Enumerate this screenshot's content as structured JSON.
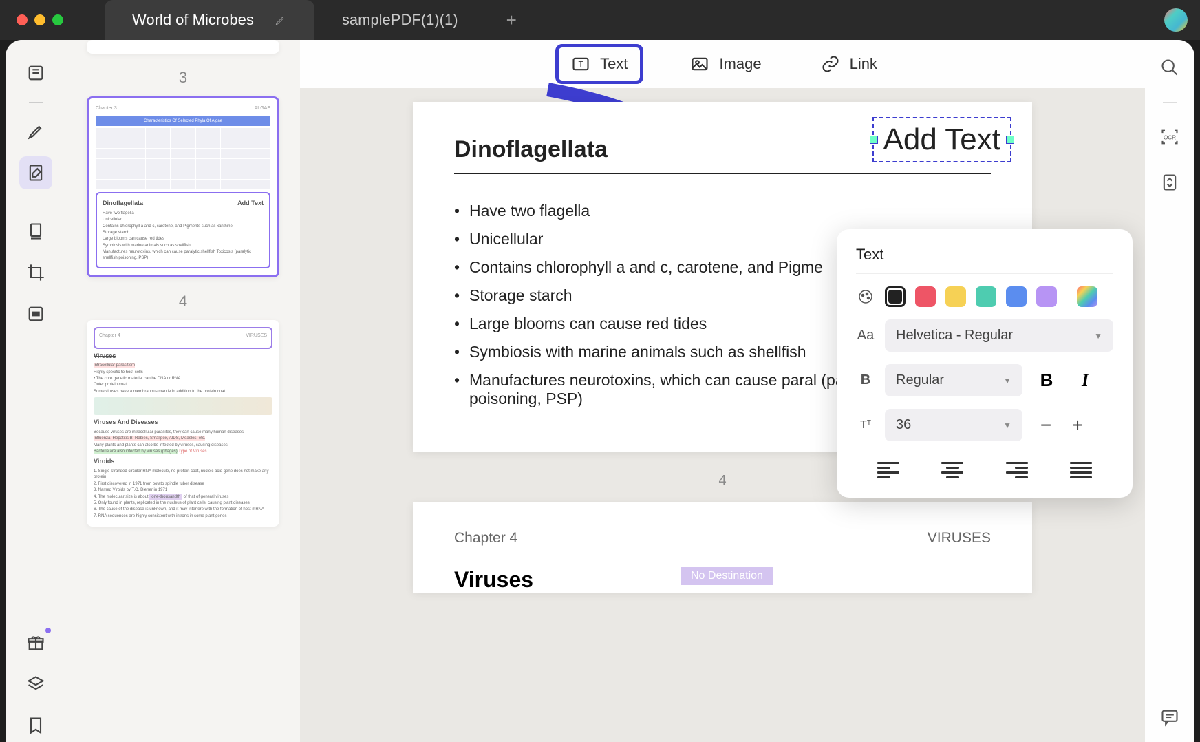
{
  "titlebar": {
    "tabs": [
      {
        "label": "World of Microbes",
        "active": true
      },
      {
        "label": "samplePDF(1)(1)",
        "active": false
      }
    ]
  },
  "thumbnails": {
    "page3_label": "3",
    "page4_label": "4",
    "thumb4": {
      "chapter": "Chapter 3",
      "subj": "ALGAE",
      "table_title": "Characteristics Of Selected Phyla Of Algae",
      "section_title": "Dinoflagellata",
      "add_text": "Add Text",
      "bullets": [
        "Have two flagella",
        "Unicellular",
        "Contains chlorophyll a and c, carotene, and Pigments such as xanthine",
        "Storage starch",
        "Large blooms can cause red tides",
        "Symbiosis with marine animals such as shellfish",
        "Manufactures neurotoxins, which can cause paralytic shellfish Toxicosis (paralytic shellfish poisoning, PSP)"
      ]
    },
    "thumb5": {
      "chapter": "Chapter 4",
      "subj": "VIRUSES",
      "h1": "Viruses",
      "sub1": "Intracellular parasitism",
      "b1": "Highly specific to host cells",
      "b2": "The core genetic material can be DNA or RNA",
      "b3": "Outer protein coat",
      "b4": "Some viruses have a membranous mantle in addition to the protein coat",
      "h2": "Viruses And Diseases",
      "b5": "Because viruses are intracellular parasites, they can cause many human diseases",
      "b6": "Influenza, Hepatitis B, Rabies, Smallpox, AIDS, Measles, etc.",
      "b7": "Many plants and plants can also be infected by viruses, causing diseases",
      "b8": "Bacteria are also infected by viruses (phages)",
      "ann": "Type of Viruses",
      "h3": "Viroids",
      "v1": "1. Single-stranded circular RNA molecule, no protein coat, nucleic acid gene does not make any protein",
      "v2": "2. First discovered in 1971 from potato spindle tuber disease",
      "v3": "3. Named Viroids by T.O. Diener in 1971",
      "v4": "4. The molecular size is about one-thousandth of that of general viruses",
      "v5": "5. Only found in plants, replicated in the nucleus of plant cells, causing plant diseases",
      "v6": "6. The cause of the disease is unknown, and it may interfere with the formation of host mRNA",
      "v7": "7. RNA sequences are highly consistent with introns in some plant genes"
    }
  },
  "toolbar": {
    "text_label": "Text",
    "image_label": "Image",
    "link_label": "Link"
  },
  "document": {
    "heading": "Dinoflagellata",
    "add_text": "Add Text",
    "bullets": [
      "Have two flagella",
      "Unicellular",
      "Contains chlorophyll a and c, carotene, and Pigme",
      "Storage starch",
      "Large blooms can cause red tides",
      "Symbiosis with marine animals such as shellfish",
      "Manufactures neurotoxins, which can cause paral (paralytic shellfish poisoning, PSP)"
    ],
    "page_number": "4",
    "next_chapter": "Chapter 4",
    "next_subj": "VIRUSES",
    "next_heading": "Viruses",
    "next_badge": "No Destination"
  },
  "text_panel": {
    "title": "Text",
    "colors": {
      "black": "#1a1a1a",
      "red": "#ee5566",
      "yellow": "#f6d155",
      "teal": "#4eccb0",
      "blue": "#5b8def",
      "purple": "#b794f4",
      "rainbow": "linear-gradient(135deg,#ff6b6b,#f6d155,#4eccb0,#5b8def,#b794f4)"
    },
    "font_family": "Helvetica - Regular",
    "font_weight": "Regular",
    "font_size": "36"
  }
}
